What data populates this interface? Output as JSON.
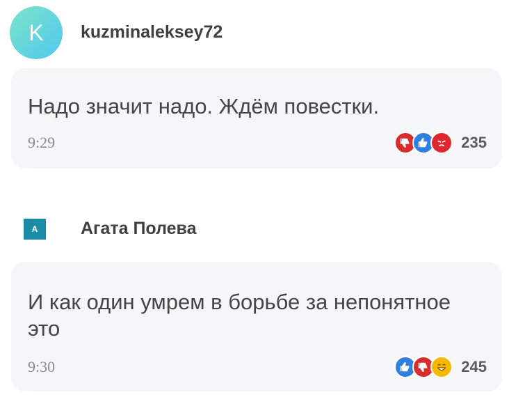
{
  "comments": [
    {
      "author": "kuzminaleksey72",
      "avatar_letter": "K",
      "text": "Надо значит надо. Ждём повестки.",
      "time": "9:29",
      "reactions": [
        "dislike-icon",
        "like-icon",
        "angry-icon"
      ],
      "reaction_count": "235"
    },
    {
      "author": "Агата Полева",
      "avatar_letter": "A",
      "text": "И как один умрем в борьбе за непонятное это",
      "time": "9:30",
      "reactions": [
        "like-icon",
        "dislike-icon",
        "laugh-icon"
      ],
      "reaction_count": "245"
    }
  ],
  "colors": {
    "like": "#2f7fe0",
    "dislike": "#d92c2c",
    "angry": "#e0262e",
    "laugh": "#f5b800",
    "bubble": "#f5f6f7"
  }
}
